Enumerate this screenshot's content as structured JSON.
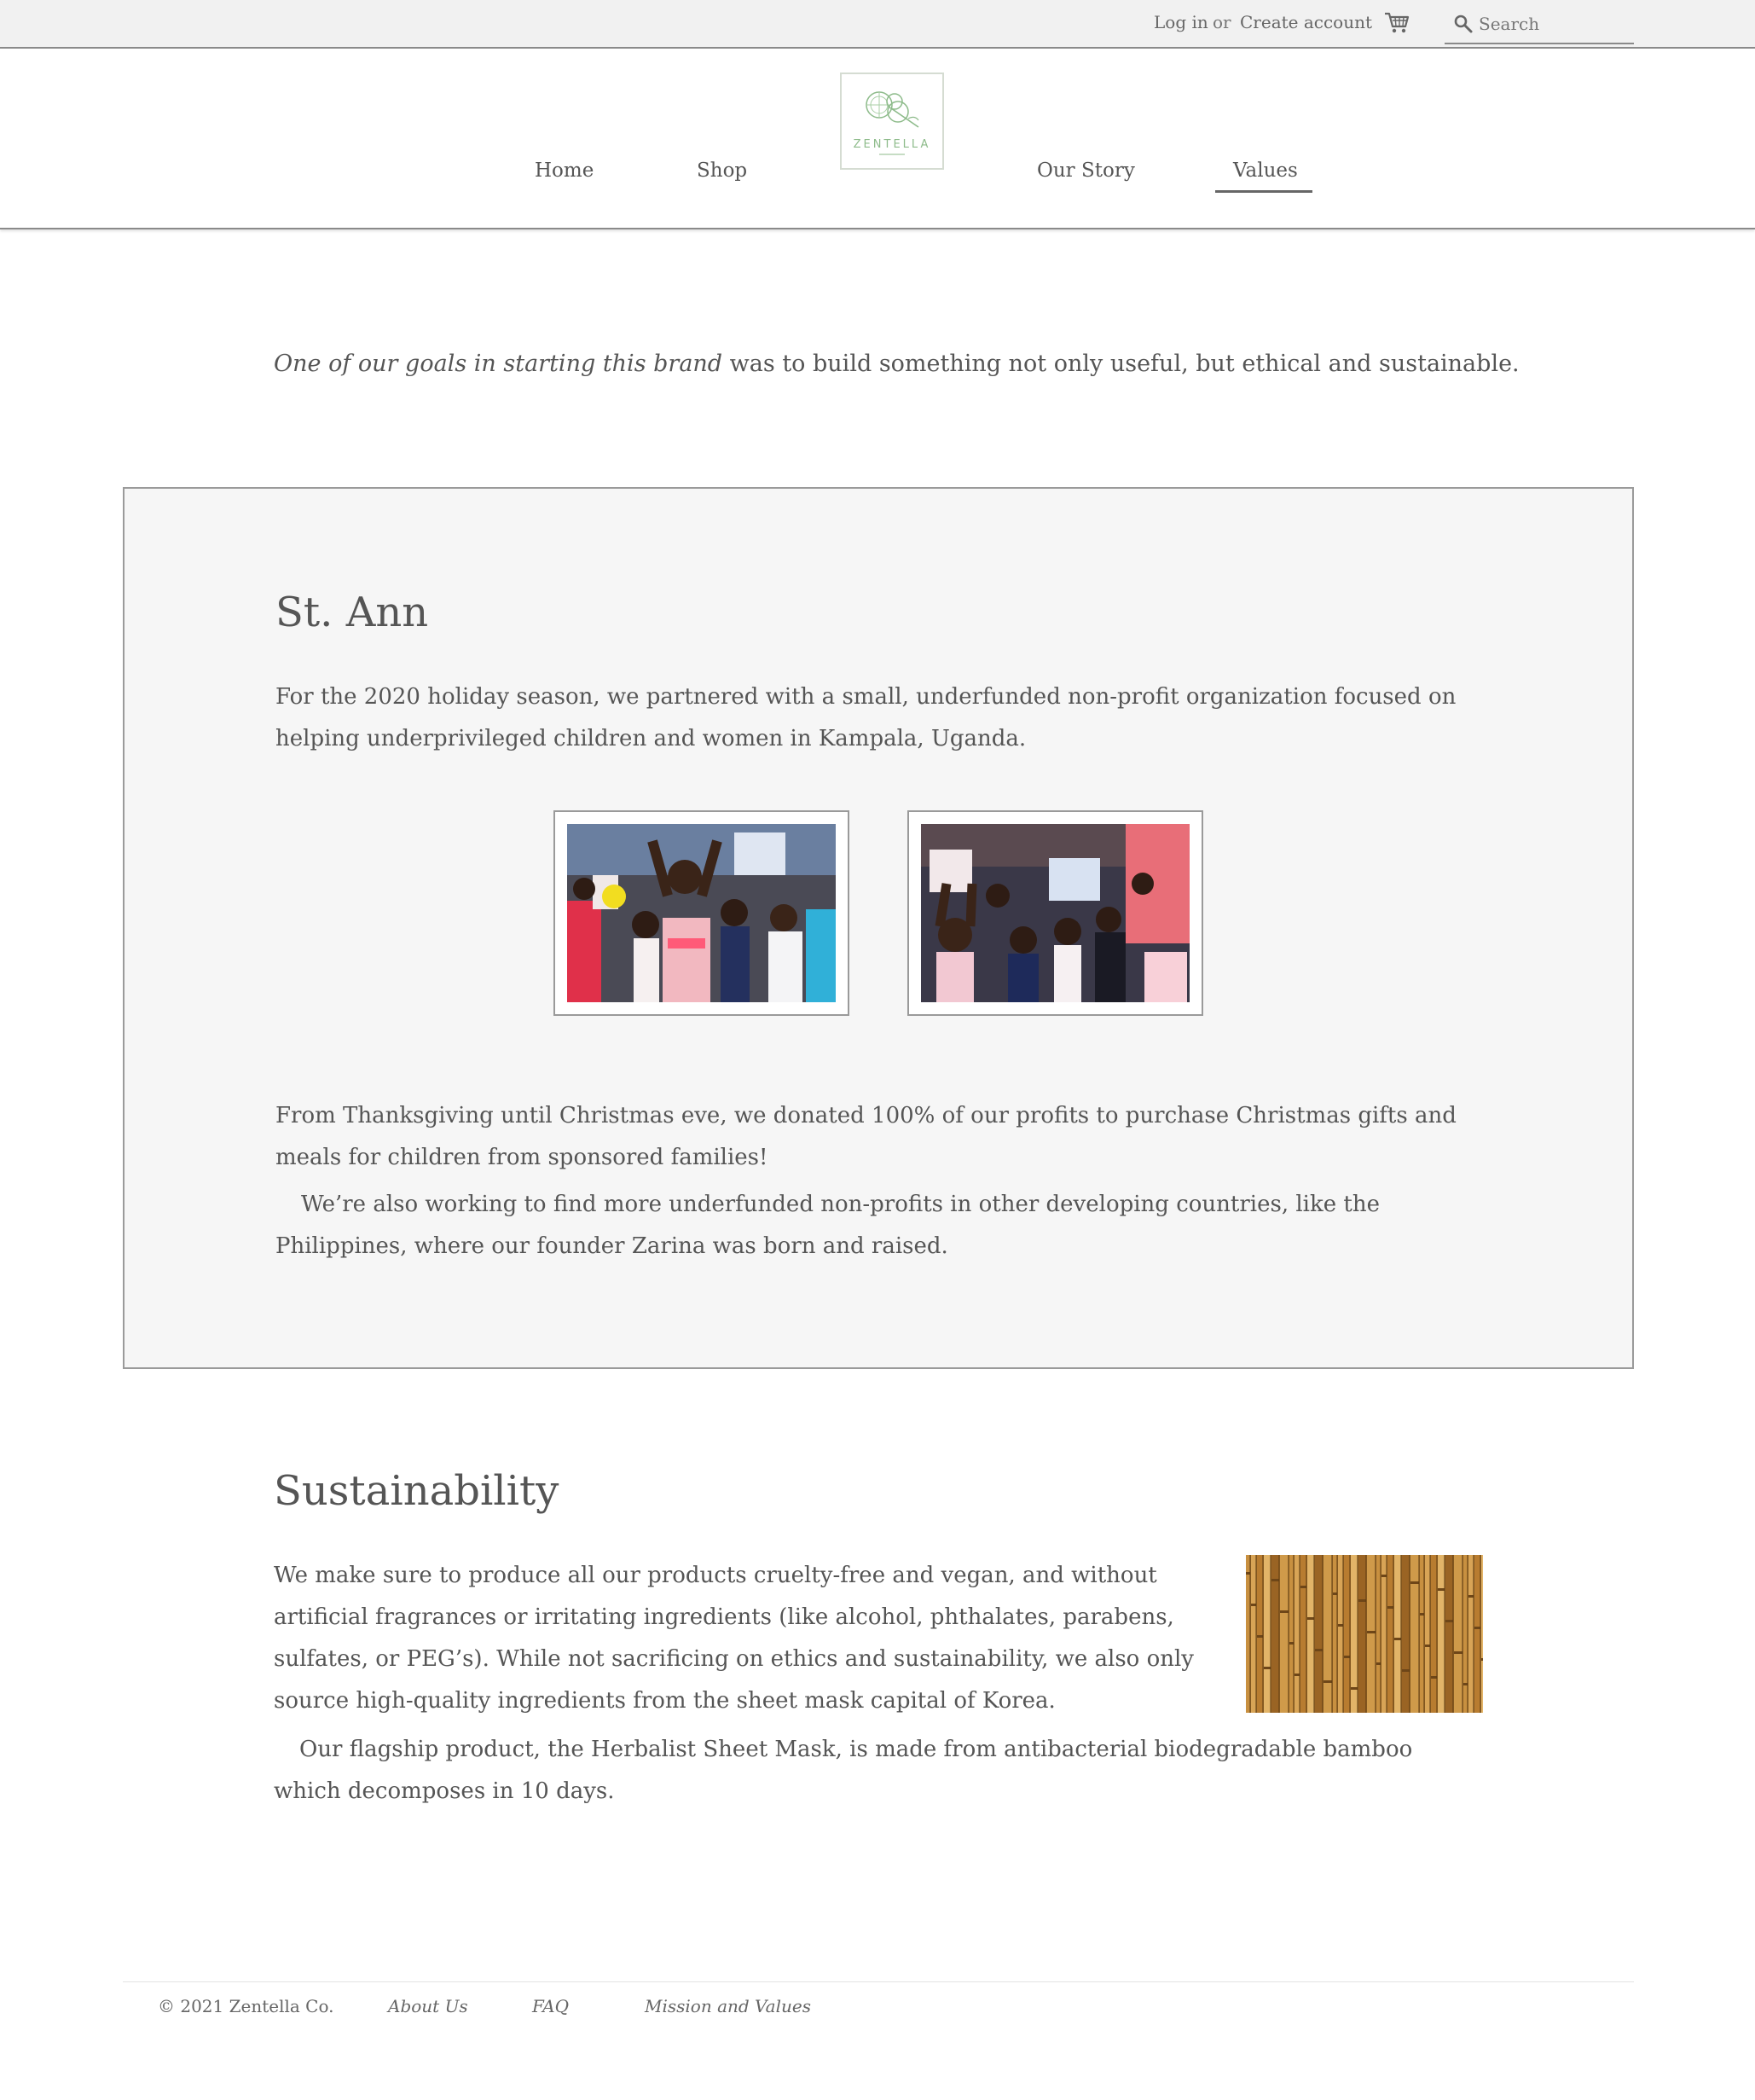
{
  "topbar": {
    "login": "Log in",
    "or": "or",
    "create_account": "Create account",
    "cart_icon": "cart-icon",
    "search_placeholder": "Search",
    "search_icon": "search-icon"
  },
  "logo": {
    "text": "ZENTELLA",
    "accent_color": "#8dbb8a"
  },
  "nav": {
    "items": [
      {
        "label": "Home"
      },
      {
        "label": "Shop"
      },
      {
        "label": "Our Story"
      },
      {
        "label": "Values",
        "active": true
      }
    ]
  },
  "intro": {
    "italic": "One of our goals in starting this brand",
    "rest": " was to build something not only useful, but ethical and sustainable."
  },
  "stann": {
    "title": "St. Ann",
    "p1": "For the 2020 holiday season, we partnered with a small, underfunded non-profit organization focused on helping underprivileged children and women in Kampala, Uganda.",
    "p2": "From Thanksgiving until Christmas eve, we donated 100% of our profits to purchase Christmas gifts and meals for children from sponsored families!",
    "p3": "We’re also working to find more underfunded non-profits in other developing countries, like the Philippines, where our founder Zarina was born and raised."
  },
  "sustainability": {
    "title": "Sustainability",
    "p1": "We make sure to produce all our products cruelty-free and vegan, and without artificial fragrances or irritating ingredients (like alcohol, phthalates, parabens, sulfates, or PEG’s). While not sacrificing on ethics and sustainability, we also only source high-quality ingredients from the sheet mask capital of Korea.",
    "p2": "Our flagship product, the Herbalist Sheet Mask, is made from antibacterial biodegradable bamboo which decomposes in 10 days."
  },
  "footer": {
    "copyright": "© 2021 Zentella Co.",
    "links": [
      "About Us",
      "FAQ",
      "Mission and Values"
    ]
  },
  "colors": {
    "text": "#555555",
    "topbar_bg": "#f1f1f1",
    "panel_bg": "#f6f6f6",
    "border": "#9a9a9a"
  }
}
